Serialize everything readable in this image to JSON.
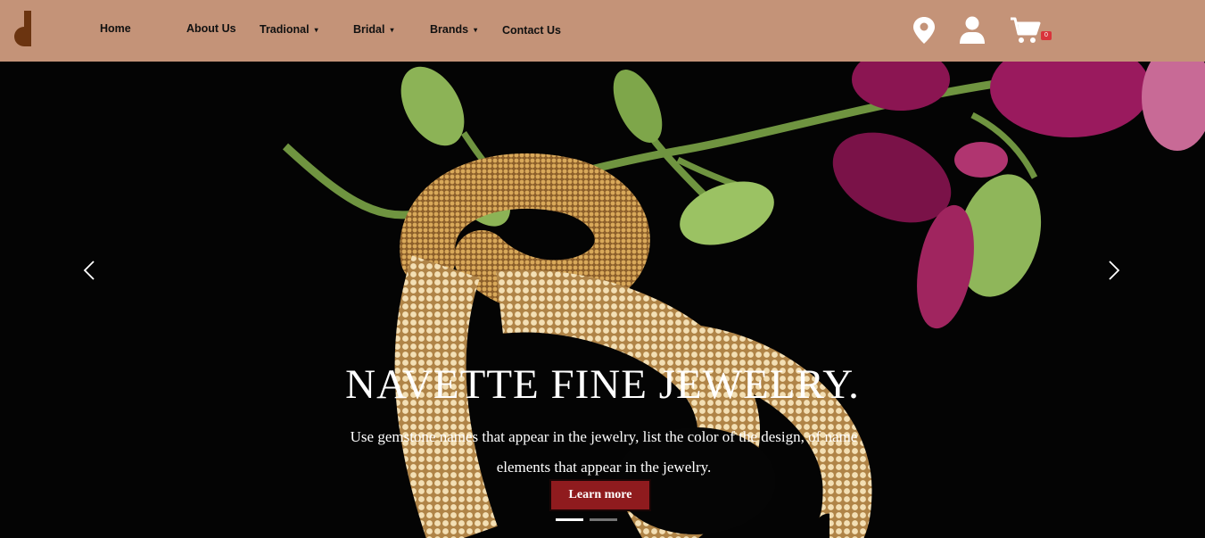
{
  "nav": {
    "items": [
      {
        "label": "Home",
        "dropdown": false
      },
      {
        "label": "About Us",
        "dropdown": false
      },
      {
        "label": "Tradional",
        "dropdown": true
      },
      {
        "label": "Bridal",
        "dropdown": true
      },
      {
        "label": "Brands",
        "dropdown": true
      },
      {
        "label": "Contact Us",
        "dropdown": false
      }
    ],
    "caret": "▾",
    "cart_count": "0",
    "icons": [
      "location-pin-icon",
      "user-icon",
      "cart-icon"
    ],
    "bar_color": "#c49378",
    "logo_color": "#6b3410"
  },
  "hero": {
    "title": "NAVETTE FINE JEWELRY.",
    "text": "Use gemstone names that appear in the jewelry, list the color of the design, of name elements that appear in the jewelry.",
    "button_label": "Learn more",
    "button_color": "#8f1b1e",
    "prev_icon": "chevron-left-icon",
    "next_icon": "chevron-right-icon",
    "slide_count": 2,
    "active_slide": 1
  }
}
